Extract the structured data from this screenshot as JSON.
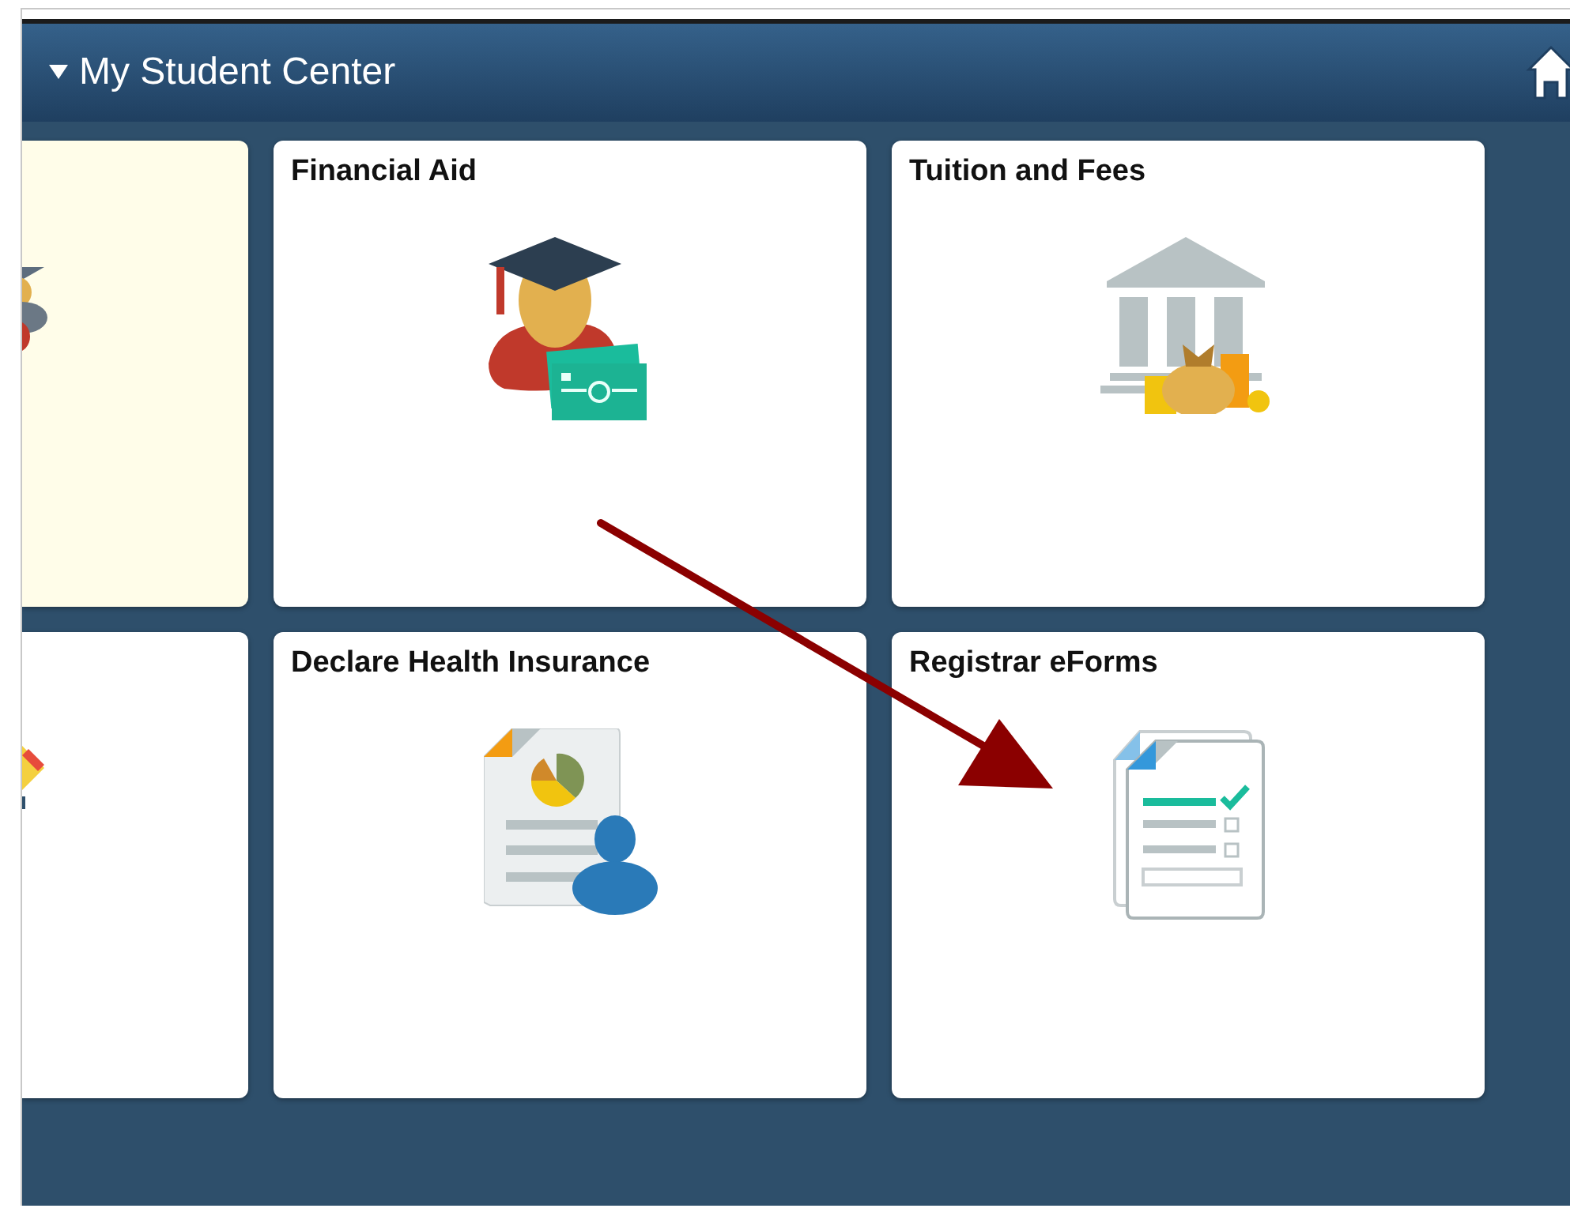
{
  "header": {
    "title": "My Student Center",
    "expanded": true
  },
  "tiles": [
    {
      "kind": "graduate",
      "highlighted": true
    },
    {
      "title": "Financial Aid",
      "kind": "aid",
      "highlighted": false
    },
    {
      "title": "Tuition and Fees",
      "kind": "bank",
      "highlighted": false
    },
    {
      "kind": "tag",
      "highlighted": false
    },
    {
      "title": "Declare Health Insurance",
      "kind": "health",
      "highlighted": false
    },
    {
      "title": "Registrar eForms",
      "kind": "eforms",
      "highlighted": false
    }
  ]
}
